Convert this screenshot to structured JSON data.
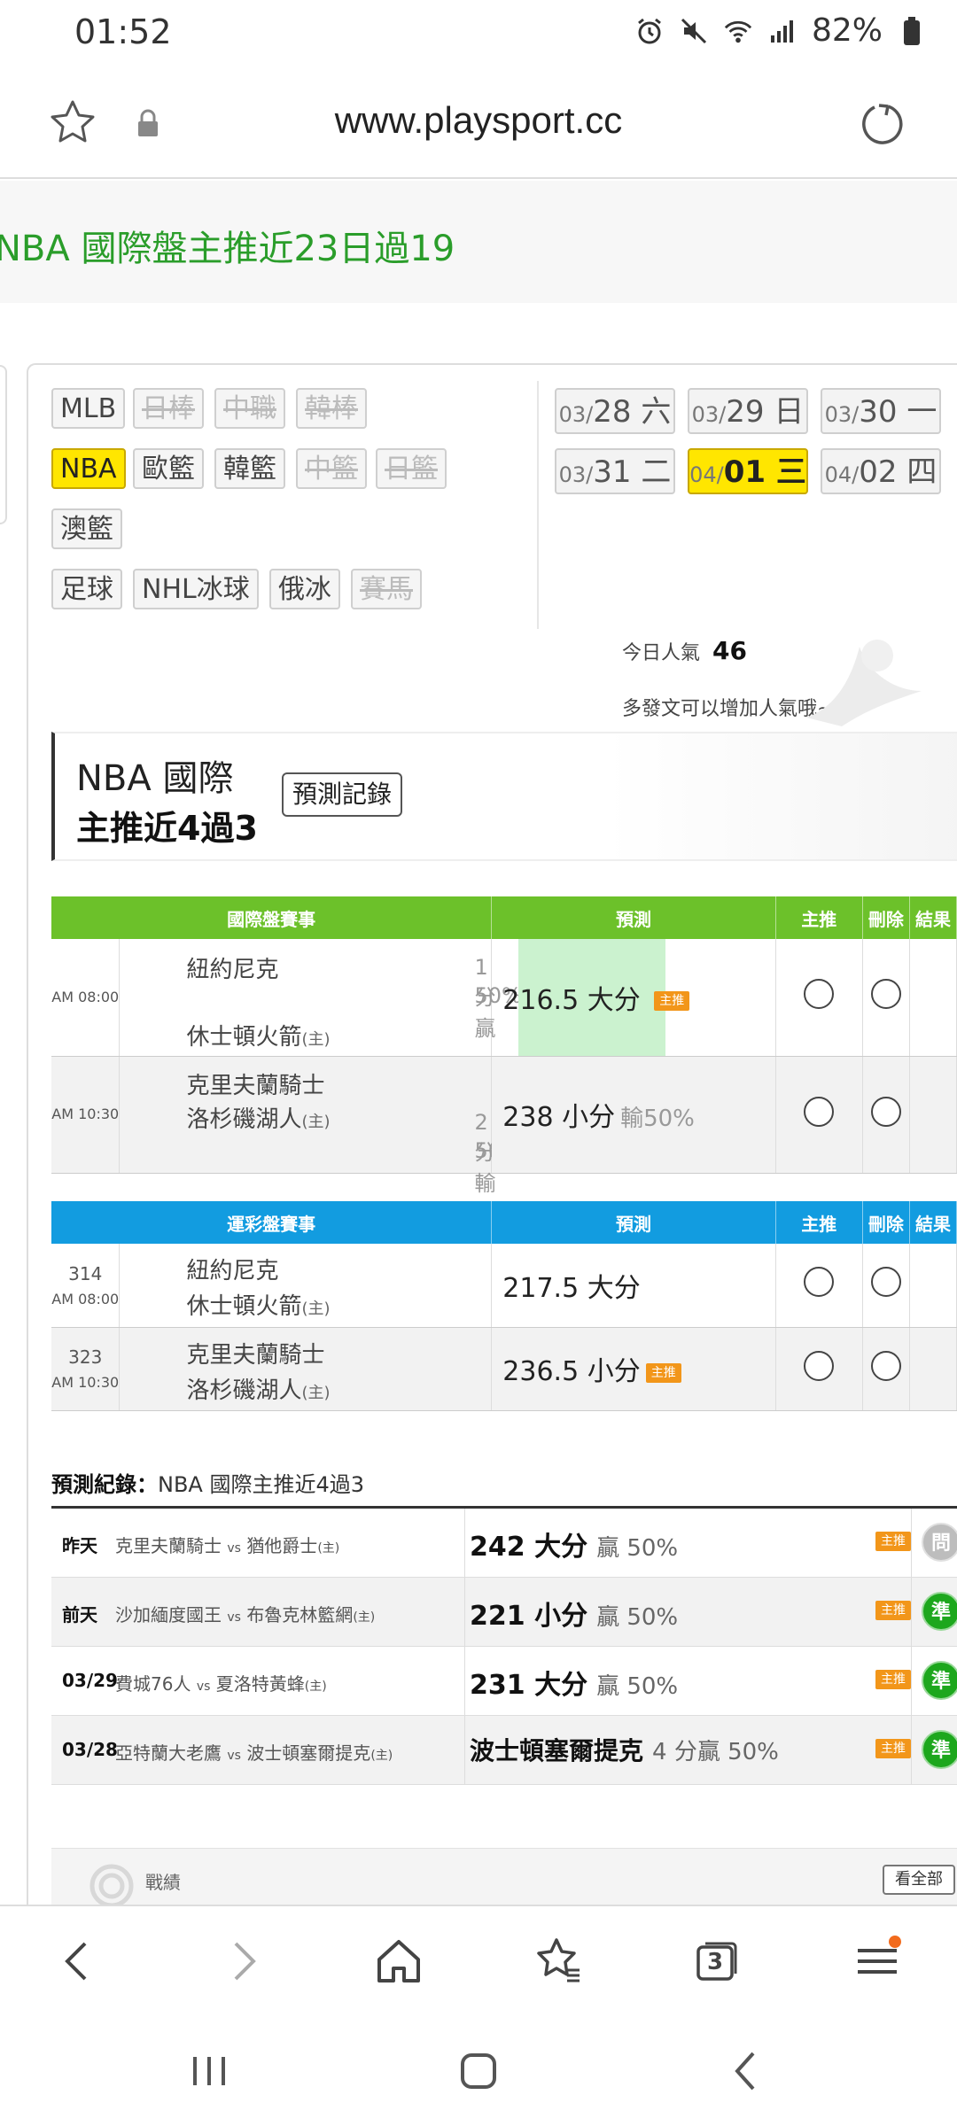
{
  "status": {
    "time": "01:52",
    "battery": "82%"
  },
  "browser": {
    "url": "www.playsport.cc",
    "tab_count": "3"
  },
  "headline": "NBA 國際盤主推近23日過19",
  "sports_row1": [
    "MLB",
    "日棒",
    "中職",
    "韓棒"
  ],
  "sports_row2": [
    "NBA",
    "歐籃",
    "韓籃",
    "中籃",
    "日籃"
  ],
  "sports_row3": [
    "澳籃"
  ],
  "sports_row4": [
    "足球",
    "NHL冰球",
    "俄冰",
    "賽馬"
  ],
  "dates": [
    {
      "mo": "03/",
      "day": "28 六"
    },
    {
      "mo": "03/",
      "day": "29 日"
    },
    {
      "mo": "03/",
      "day": "30 一"
    },
    {
      "mo": "03/",
      "day": "31 二"
    },
    {
      "mo": "04/",
      "day": "01 三"
    },
    {
      "mo": "04/",
      "day": "02 四"
    }
  ],
  "popularity": {
    "label": "今日人氣",
    "value": "46",
    "note": "多發文可以增加人氣哦~"
  },
  "title": {
    "line1": "NBA 國際",
    "line2": "主推近4過3",
    "record_button": "預測記錄"
  },
  "intl_table": {
    "headers": [
      "國際盤賽事",
      "預測",
      "主推",
      "刪除",
      "結果"
    ],
    "rows": [
      {
        "time": "AM 08:00",
        "away": "紐約尼克",
        "home": "休士頓火箭",
        "home_tag": "(主)",
        "odds1": "1分贏",
        "odds2": "50%",
        "pred": "216.5 大分",
        "pred_sub": "",
        "badge": "主推"
      },
      {
        "time": "AM 10:30",
        "away": "克里夫蘭騎士",
        "home": "洛杉磯湖人",
        "home_tag": "(主)",
        "odds1": "2分輸",
        "odds2": "50%",
        "pred": "238 小分",
        "pred_sub": "輸50%",
        "badge": ""
      }
    ]
  },
  "lottery_table": {
    "headers": [
      "運彩盤賽事",
      "預測",
      "主推",
      "刪除",
      "結果"
    ],
    "rows": [
      {
        "num": "314",
        "time": "AM 08:00",
        "away": "紐約尼克",
        "home": "休士頓火箭",
        "home_tag": "(主)",
        "pred": "217.5 大分",
        "badge": ""
      },
      {
        "num": "323",
        "time": "AM 10:30",
        "away": "克里夫蘭騎士",
        "home": "洛杉磯湖人",
        "home_tag": "(主)",
        "pred": "236.5 小分",
        "badge": "主推"
      }
    ]
  },
  "history": {
    "title_label": "預測紀錄：",
    "title_value": "NBA 國際主推近4過3",
    "badge": "主推",
    "rows": [
      {
        "date": "昨天",
        "away": "克里夫蘭騎士",
        "home": "猶他爵士",
        "pick": "242 大分",
        "result_text": "贏 50%",
        "result": "問"
      },
      {
        "date": "前天",
        "away": "沙加緬度國王",
        "home": "布魯克林籃網",
        "pick": "221 小分",
        "result_text": "贏 50%",
        "result": "準"
      },
      {
        "date": "03/29",
        "away": "費城76人",
        "home": "夏洛特黃蜂",
        "pick": "231 大分",
        "result_text": "贏 50%",
        "result": "準"
      },
      {
        "date": "03/28",
        "away": "亞特蘭大老鷹",
        "home": "波士頓塞爾提克",
        "pick": "波士頓塞爾提克",
        "result_text": "4 分贏 50%",
        "result": "準"
      }
    ],
    "vs": "vs",
    "home_tag": "(主)"
  },
  "stats_bar": {
    "label": "戰績",
    "view_all": "看全部"
  },
  "colors": {
    "green_header": "#6cc12a",
    "blue_header": "#129ce0",
    "selected": "#ffe600",
    "badge": "#f2961a"
  }
}
